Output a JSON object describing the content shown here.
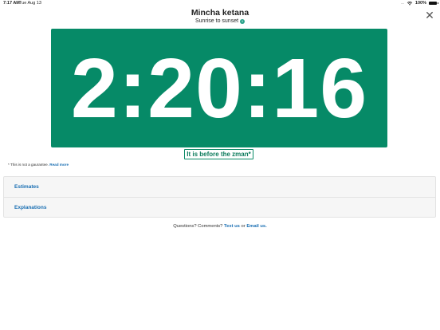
{
  "status_bar": {
    "time": "7:17 AM",
    "date": "Tue Aug 13",
    "signal": "....",
    "battery_pct": "100%"
  },
  "header": {
    "title": "Mincha ketana",
    "subtitle": "Sunrise to sunset",
    "info_icon": "info-icon",
    "close_icon": "close-icon",
    "close_glyph": "✕"
  },
  "timer": {
    "value": "2:20:16",
    "background": "#068a67"
  },
  "status": {
    "text": "It is before the zman*"
  },
  "disclaimer": {
    "text": "* This is not a gaurantee.",
    "link": "Read more"
  },
  "sections": [
    {
      "label": "Estimates"
    },
    {
      "label": "Explanations"
    }
  ],
  "footer": {
    "prefix": "Questions? Comments?",
    "text_link": "Text us",
    "or": "or",
    "email_link": "Email us."
  },
  "colors": {
    "accent": "#068a67",
    "link": "#1a6fb3"
  }
}
